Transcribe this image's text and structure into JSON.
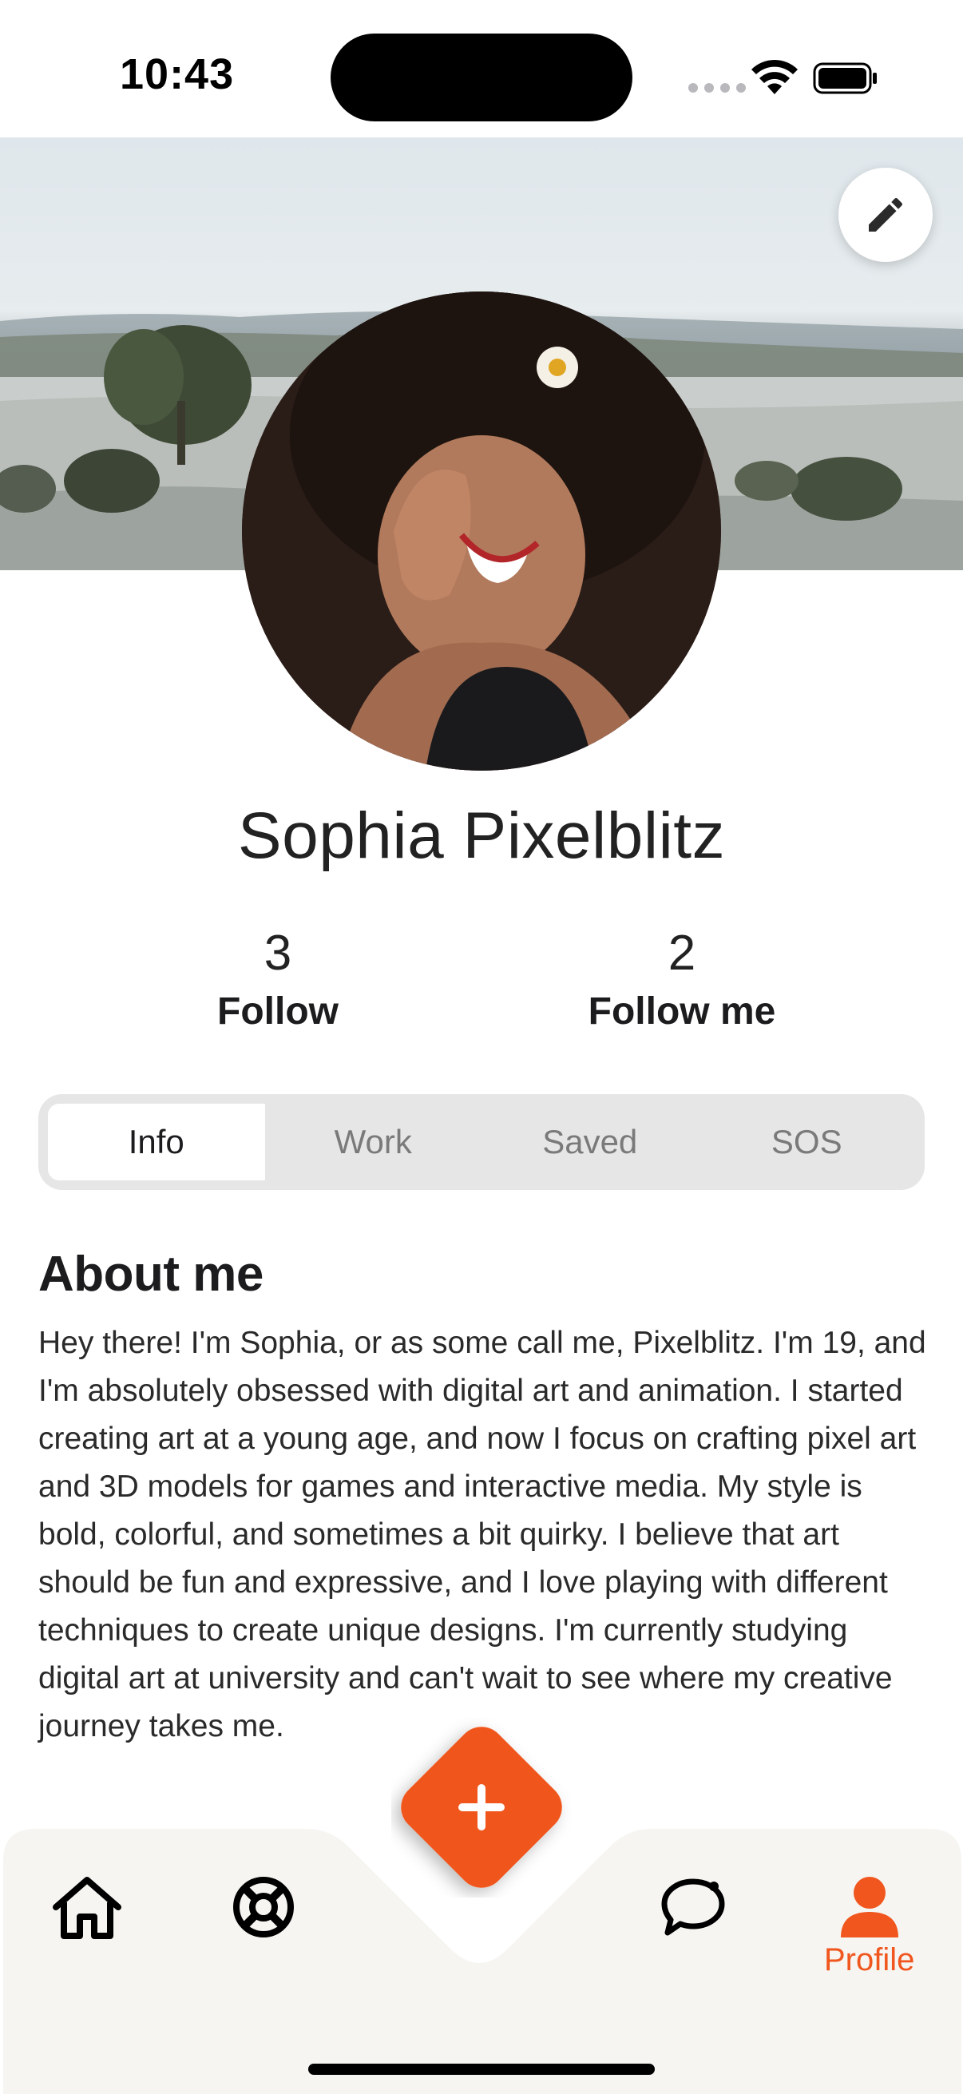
{
  "status_bar": {
    "time": "10:43"
  },
  "profile": {
    "name": "Sophia Pixelblitz",
    "stats": [
      {
        "count": "3",
        "label": "Follow"
      },
      {
        "count": "2",
        "label": "Follow me"
      }
    ]
  },
  "tabs": [
    {
      "label": "Info",
      "active": true
    },
    {
      "label": "Work",
      "active": false
    },
    {
      "label": "Saved",
      "active": false
    },
    {
      "label": "SOS",
      "active": false
    }
  ],
  "about": {
    "title": "About me",
    "text": "Hey there! I'm Sophia, or as some call me, Pixelblitz. I'm 19, and I'm absolutely obsessed with digital art and animation. I started creating art at a young age, and now I focus on crafting pixel art and 3D models for games and interactive media. My style is bold, colorful, and sometimes a bit quirky. I believe that art should be fun and expressive, and I love playing with different techniques to create unique designs. I'm currently studying digital art at university and can't wait to see where my creative journey takes me."
  },
  "nav": {
    "items": [
      {
        "icon": "home-icon"
      },
      {
        "icon": "lifebuoy-icon"
      },
      {
        "icon": "chat-icon"
      },
      {
        "icon": "profile-icon",
        "label": "Profile",
        "active": true
      }
    ],
    "fab_icon": "plus-icon"
  },
  "colors": {
    "accent": "#f0561d",
    "nav_background": "#f6f5f2",
    "tab_track": "#e6e6e6"
  }
}
